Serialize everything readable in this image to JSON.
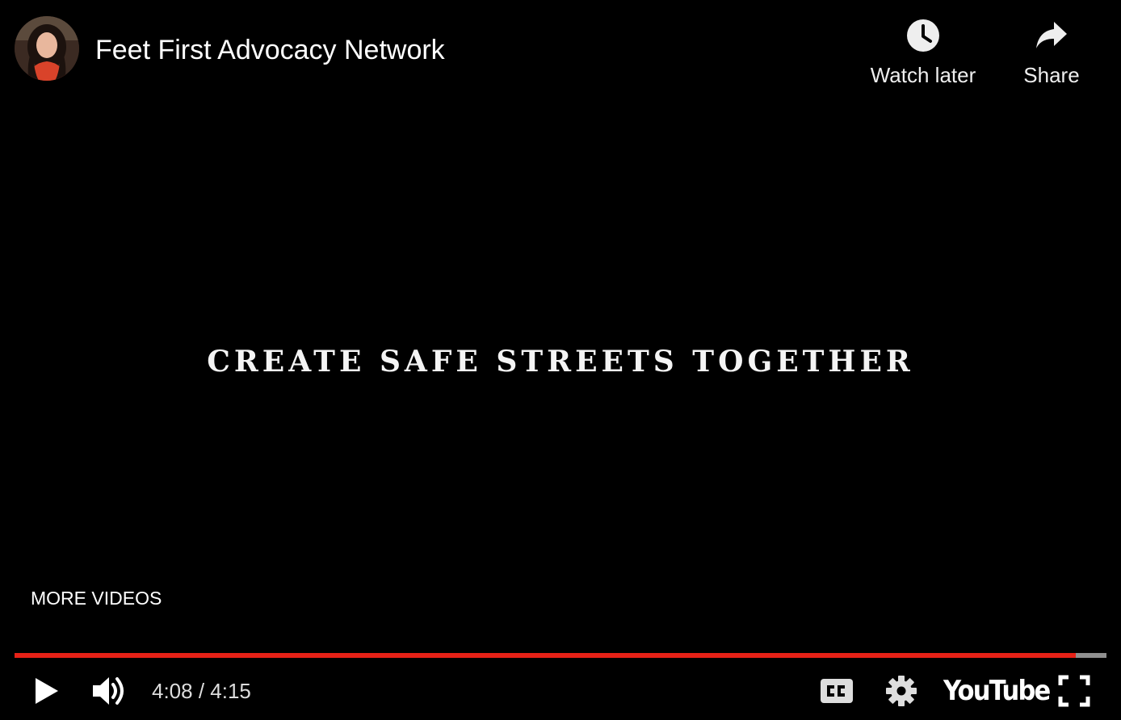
{
  "header": {
    "channel_name": "Feet First Advocacy Network",
    "watch_later_label": "Watch later",
    "share_label": "Share"
  },
  "video": {
    "overlay_text": "CREATE SAFE STREETS TOGETHER"
  },
  "more_videos_label": "MORE VIDEOS",
  "player": {
    "current_time": "4:08",
    "duration": "4:15",
    "time_display": "4:08 / 4:15",
    "played_fraction": 0.972,
    "buffered_fraction": 1.0,
    "brand": "YouTube"
  },
  "icons": {
    "watch_later": "clock-icon",
    "share": "share-arrow-icon",
    "play": "play-icon",
    "volume": "volume-high-icon",
    "captions": "closed-captions-icon",
    "settings": "gear-icon",
    "fullscreen": "fullscreen-icon"
  },
  "colors": {
    "progress_played": "#e62117",
    "progress_buffered": "#8f8f8f",
    "background": "#000000",
    "text": "#ffffff"
  }
}
